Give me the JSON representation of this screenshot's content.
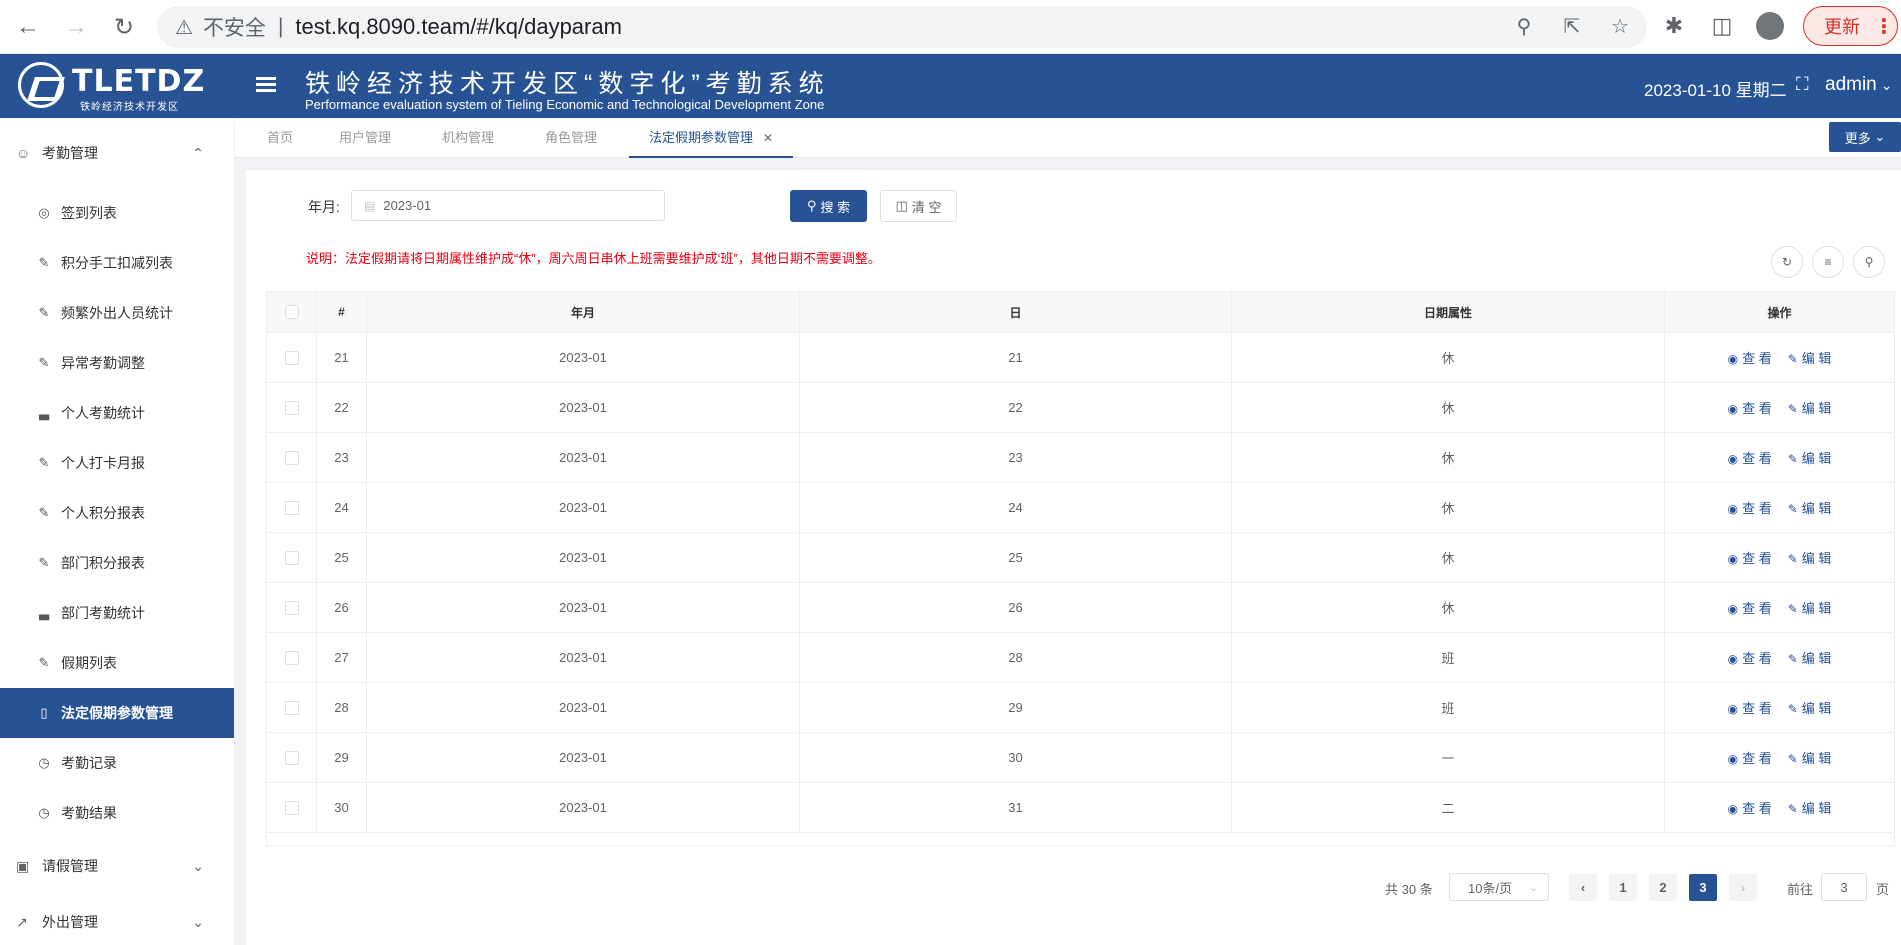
{
  "browser": {
    "warning": "不安全",
    "url": "test.kq.8090.team/#/kq/dayparam",
    "update_label": "更新"
  },
  "header": {
    "logo_text": "TLETDZ",
    "logo_sub": "铁岭经济技术开发区",
    "title": "铁岭经济技术开发区“数字化”考勤系统",
    "subtitle": "Performance evaluation system of Tieling Economic and Technological Development Zone",
    "date": "2023-01-10 星期二",
    "user": "admin"
  },
  "sidebar": {
    "group1": "考勤管理",
    "items": [
      {
        "label": "签到列表",
        "icon": "location-icon"
      },
      {
        "label": "积分手工扣减列表",
        "icon": "edit-icon"
      },
      {
        "label": "频繁外出人员统计",
        "icon": "edit-icon"
      },
      {
        "label": "异常考勤调整",
        "icon": "edit-icon"
      },
      {
        "label": "个人考勤统计",
        "icon": "bar-chart-icon"
      },
      {
        "label": "个人打卡月报",
        "icon": "edit-icon"
      },
      {
        "label": "个人积分报表",
        "icon": "edit-icon"
      },
      {
        "label": "部门积分报表",
        "icon": "edit-icon"
      },
      {
        "label": "部门考勤统计",
        "icon": "bar-chart-icon"
      },
      {
        "label": "假期列表",
        "icon": "edit-icon"
      },
      {
        "label": "法定假期参数管理",
        "icon": "notebook-icon"
      },
      {
        "label": "考勤记录",
        "icon": "clock-icon"
      },
      {
        "label": "考勤结果",
        "icon": "clock-icon"
      }
    ],
    "group2": "请假管理",
    "group3": "外出管理"
  },
  "tabs": [
    "首页",
    "用户管理",
    "机构管理",
    "角色管理",
    "法定假期参数管理"
  ],
  "more_label": "更多",
  "search": {
    "label": "年月:",
    "value": "2023-01",
    "search_btn": "搜 索",
    "clear_btn": "清 空"
  },
  "notice": "说明：法定假期请将日期属性维护成“休”，周六周日串休上班需要维护成‘班”，其他日期不需要调整。",
  "table": {
    "headers": [
      "#",
      "年月",
      "日",
      "日期属性",
      "操作"
    ],
    "view_label": "查 看",
    "edit_label": "编 辑",
    "rows": [
      {
        "idx": "21",
        "ym": "2023-01",
        "day": "21",
        "attr": "休"
      },
      {
        "idx": "22",
        "ym": "2023-01",
        "day": "22",
        "attr": "休"
      },
      {
        "idx": "23",
        "ym": "2023-01",
        "day": "23",
        "attr": "休"
      },
      {
        "idx": "24",
        "ym": "2023-01",
        "day": "24",
        "attr": "休"
      },
      {
        "idx": "25",
        "ym": "2023-01",
        "day": "25",
        "attr": "休"
      },
      {
        "idx": "26",
        "ym": "2023-01",
        "day": "26",
        "attr": "休"
      },
      {
        "idx": "27",
        "ym": "2023-01",
        "day": "28",
        "attr": "班"
      },
      {
        "idx": "28",
        "ym": "2023-01",
        "day": "29",
        "attr": "班"
      },
      {
        "idx": "29",
        "ym": "2023-01",
        "day": "30",
        "attr": "一"
      },
      {
        "idx": "30",
        "ym": "2023-01",
        "day": "31",
        "attr": "二"
      }
    ]
  },
  "pagination": {
    "total": "共 30 条",
    "page_size": "10条/页",
    "pages": [
      "1",
      "2",
      "3"
    ],
    "current": "3",
    "goto_label": "前往",
    "goto_value": "3",
    "page_suffix": "页"
  },
  "colors": {
    "primary": "#275294",
    "notice": "#e60012"
  }
}
